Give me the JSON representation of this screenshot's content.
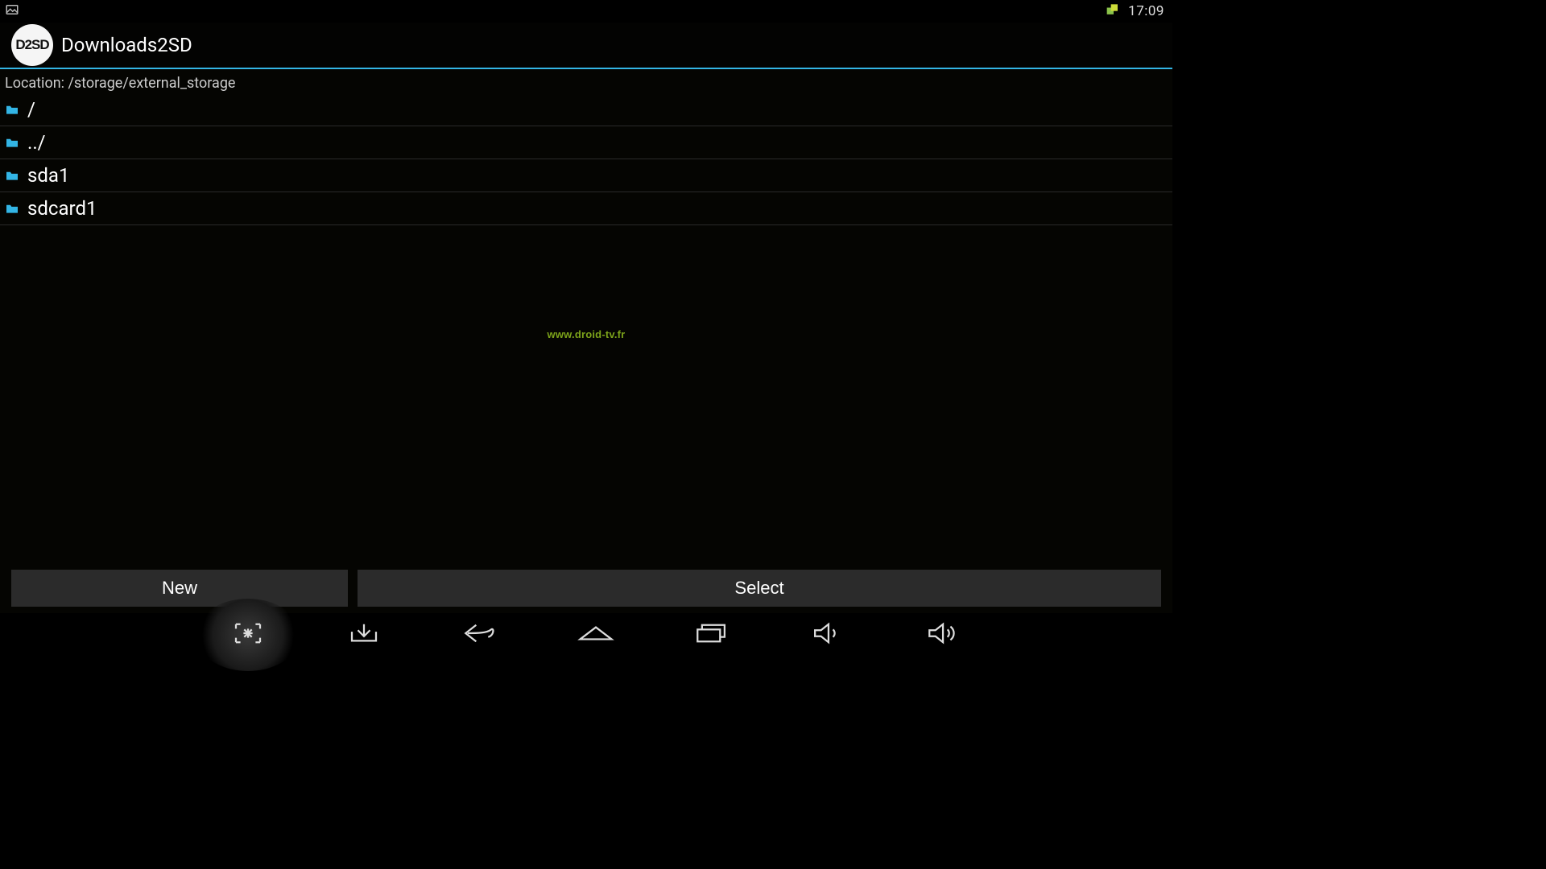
{
  "status_bar": {
    "clock": "17:09"
  },
  "header": {
    "app_icon_label": "D2SD",
    "app_title": "Downloads2SD"
  },
  "location": {
    "label_prefix": "Location: ",
    "path": "/storage/external_storage"
  },
  "files": [
    {
      "name": "/"
    },
    {
      "name": "../"
    },
    {
      "name": "sda1"
    },
    {
      "name": "sdcard1"
    }
  ],
  "watermark": "www.droid-tv.fr",
  "actions": {
    "new_label": "New",
    "select_label": "Select"
  }
}
